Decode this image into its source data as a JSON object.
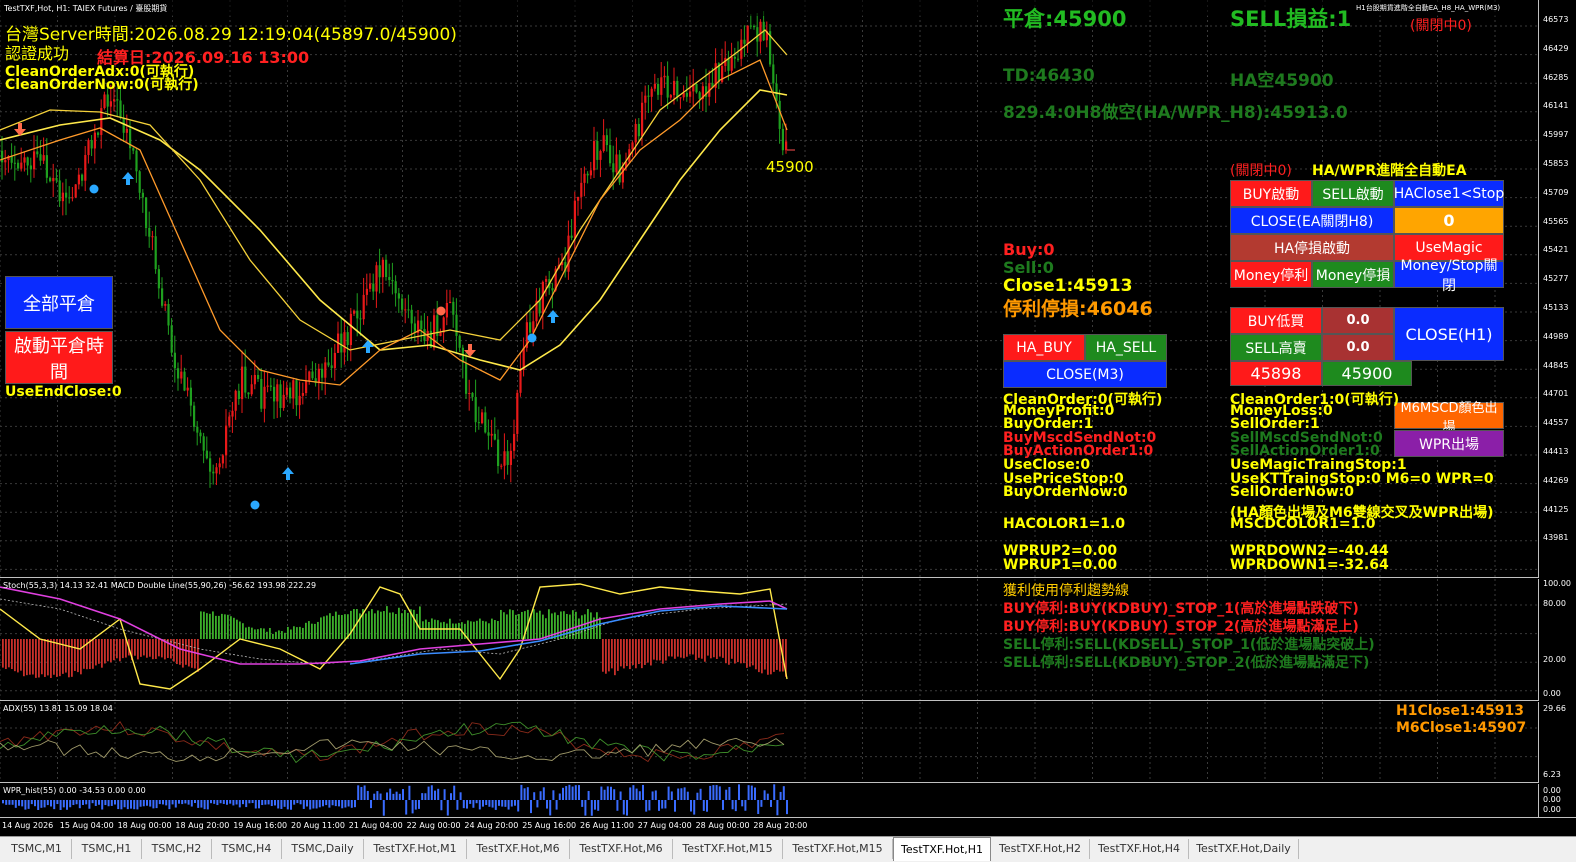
{
  "window": {
    "title": "TestTXF,Hot, H1:  TAIEX Futures / 臺股期貨",
    "right_title": "H1台股期貨進階全自動EA_H8_HA_WPR(M3)"
  },
  "info": {
    "server_time": "台灣Server時間:2026.08.29 12:19:04(45897.0/45900)",
    "auth": "認證成功",
    "settle": "結算日:2026.09.16 13:00",
    "clean_adx": "CleanOrderAdx:0(可執行)",
    "clean_now": "CleanOrderNow:0(可執行)",
    "use_end_close": "UseEndClose:0",
    "ping_cang": "平倉:45900",
    "sell_pnl": "SELL損益:1",
    "close_status": "(關閉中0)",
    "td": "TD:46430",
    "ha_empty": "HA空45900",
    "h8_line": "829.4:0H8做空(HA/WPR_H8):45913.0",
    "price_label": "45900"
  },
  "left_buttons": {
    "close_all": "全部平倉",
    "start_close_time": "啟動平倉時間"
  },
  "mid_status": {
    "buy": "Buy:0",
    "sell": "Sell:0",
    "close1": "Close1:45913",
    "tp_sl": "停利停損:46046"
  },
  "ha_buttons": {
    "ha_buy": "HA_BUY",
    "ha_sell": "HA_SELL",
    "close_m3": "CLOSE(M3)"
  },
  "ea_panel": {
    "title_status": "(關閉中0)",
    "title": "HA/WPR進階全自動EA",
    "buy_start": "BUY啟動",
    "sell_start": "SELL啟動",
    "haclose": "HAClose1<Stop",
    "close_ea": "CLOSE(EA關閉H8)",
    "zero": "0",
    "ha_stop": "HA停損啟動",
    "use_magic": "UseMagic",
    "money_tp": "Money停利",
    "money_sl": "Money停損",
    "money_stop_close": "Money/Stop關閉",
    "buy_low": "BUY低買",
    "buy_low_val": "0.0",
    "sell_high": "SELL高賣",
    "sell_high_val": "0.0",
    "close_h1": "CLOSE(H1)",
    "bid": "45898",
    "ask": "45900",
    "msc_out": "M6MSCD顏色出場",
    "wpr_out": "WPR出場"
  },
  "left_stats": [
    {
      "text": "CleanOrder:0(可執行)",
      "color": "yel"
    },
    {
      "text": "MoneyProfit:0",
      "color": "yel"
    },
    {
      "text": "BuyOrder:1",
      "color": "yel"
    },
    {
      "text": "BuyMscdSendNot:0",
      "color": "red"
    },
    {
      "text": "BuyActionOrder1:0",
      "color": "red"
    },
    {
      "text": "UseClose:0",
      "color": "yel"
    },
    {
      "text": "UsePriceStop:0",
      "color": "yel"
    },
    {
      "text": "BuyOrderNow:0",
      "color": "yel"
    }
  ],
  "right_stats": [
    {
      "text": "CleanOrder1:0(可執行)",
      "color": "yel"
    },
    {
      "text": "MoneyLoss:0",
      "color": "yel"
    },
    {
      "text": "SellOrder:1",
      "color": "yel"
    },
    {
      "text": "SellMscdSendNot:0",
      "color": "dgrn"
    },
    {
      "text": "SellActionOrder1:0",
      "color": "dgrn"
    },
    {
      "text": "UseMagicTraingStop:1",
      "color": "yel"
    },
    {
      "text": "UseKTTraingStop:0  M6=0  WPR=0",
      "color": "yel"
    },
    {
      "text": "SellOrderNow:0",
      "color": "yel"
    }
  ],
  "ha_note": "(HA顏色出場及M6雙線交叉及WPR出場)",
  "hacolor": "HACOLOR1=1.0",
  "mscdcolor": "MSCDCOLOR1=1.0",
  "wprup2": "WPRUP2=0.00",
  "wprup1": "WPRUP1=0.00",
  "wprdown2": "WPRDOWN2=-40.44",
  "wprdown1": "WPRDOWN1=-32.64",
  "stoch": {
    "label": "Stoch(55,3,3) 14.13 32.41 MACD Double Line(55,90,26) -56.62 193.98 222.29",
    "title": "獲利使用停利趨勢線",
    "lines": [
      {
        "text": "BUY停利:BUY(KDBUY)_STOP_1(高於進場點跌破下)",
        "color": "red"
      },
      {
        "text": "BUY停利:BUY(KDBUY)_STOP_2(高於進場點滿足上)",
        "color": "red"
      },
      {
        "text": "SELL停利:SELL(KDSELL)_STOP_1(低於進場點突破上)",
        "color": "dgrn"
      },
      {
        "text": "SELL停利:SELL(KDBUY)_STOP_2(低於進場點滿足下)",
        "color": "dgrn"
      }
    ],
    "scale": [
      "100.00",
      "80.00",
      "20.00",
      "0.00"
    ]
  },
  "adx": {
    "label": "ADX(55) 13.81 15.09 18.04",
    "h1close": "H1Close1:45913",
    "m6close": "M6Close1:45907",
    "scale": [
      "29.66",
      "6.23"
    ]
  },
  "wpr": {
    "label": "WPR_hist(55) 0.00 -34.53 0.00 0.00",
    "scale": [
      "0.00",
      "0.00",
      "0.00"
    ]
  },
  "price_scale": [
    "46573",
    "46429",
    "46285",
    "46141",
    "45997",
    "45853",
    "45709",
    "45565",
    "45421",
    "45277",
    "45133",
    "44989",
    "44845",
    "44701",
    "44557",
    "44413",
    "44269",
    "44125",
    "43981"
  ],
  "time_scale": [
    "14 Aug 2026",
    "15 Aug 04:00",
    "18 Aug 00:00",
    "18 Aug 20:00",
    "19 Aug 16:00",
    "20 Aug 11:00",
    "21 Aug 04:00",
    "22 Aug 00:00",
    "24 Aug 20:00",
    "25 Aug 16:00",
    "26 Aug 11:00",
    "27 Aug 04:00",
    "28 Aug 00:00",
    "28 Aug 20:00"
  ],
  "tabs": [
    "TSMC,M1",
    "TSMC,H1",
    "TSMC,H2",
    "TSMC,H4",
    "TSMC,Daily",
    "TestTXF.Hot,M1",
    "TestTXF.Hot,M6",
    "TestTXF.Hot,M6",
    "TestTXF.Hot,M15",
    "TestTXF.Hot,M15",
    "TestTXF.Hot,H1",
    "TestTXF.Hot,H2",
    "TestTXF.Hot,H4",
    "TestTXF.Hot,Daily"
  ],
  "active_tab": 10
}
